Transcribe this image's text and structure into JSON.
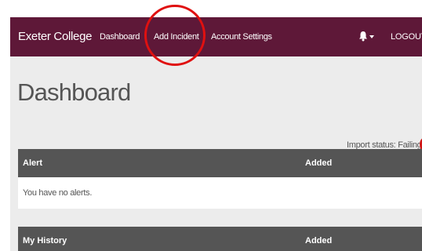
{
  "navbar": {
    "brand": "Exeter College",
    "links": [
      {
        "label": "Dashboard"
      },
      {
        "label": "Add Incident"
      },
      {
        "label": "Account Settings"
      }
    ],
    "logout_label": "LOGOUT"
  },
  "page": {
    "title": "Dashboard",
    "import_status": "Import status: Failing"
  },
  "alerts_table": {
    "columns": [
      "Alert",
      "Added"
    ],
    "empty_message": "You have no alerts."
  },
  "history_table": {
    "columns": [
      "My History",
      "Added"
    ]
  },
  "colors": {
    "navbar": "#5e1838",
    "table_header": "#555555",
    "status_failing": "#d01818",
    "highlight": "#e01010"
  },
  "icons": {
    "notifications": "bell-icon",
    "dropdown": "caret-down-icon"
  }
}
